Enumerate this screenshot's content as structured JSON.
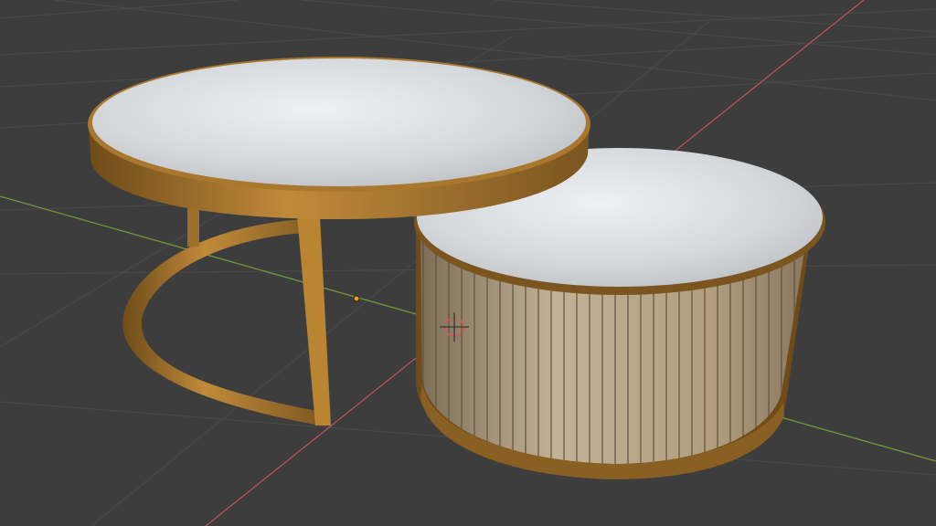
{
  "viewport": {
    "background": "#3d3d3d",
    "grid_color": "#494949",
    "x_axis_color": "#b8505e",
    "y_axis_color": "#6c9a36",
    "marble_color": "#d9dcdf",
    "gold_color": "#a9782e",
    "wood_color": "#b8a486"
  }
}
